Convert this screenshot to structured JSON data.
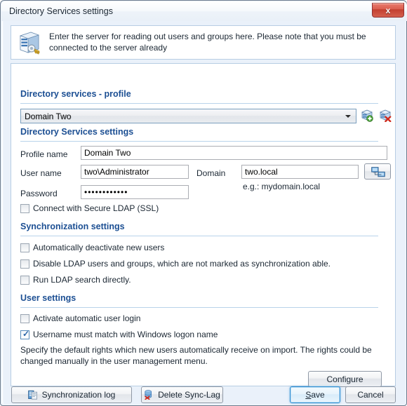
{
  "window": {
    "title": "Directory Services settings",
    "close_label": "x"
  },
  "banner": {
    "icon": "server-key-icon",
    "text": "Enter the server for reading out users and groups here. Please note that you must be connected to the server already"
  },
  "profile_section": {
    "heading": "Directory services - profile",
    "combo_value": "Domain Two",
    "add_icon": "add-server-icon",
    "delete_icon": "delete-server-icon"
  },
  "settings_section": {
    "heading": "Directory Services settings",
    "fields": {
      "profile_name_label": "Profile name",
      "profile_name_value": "Domain Two",
      "user_name_label": "User name",
      "user_name_value": "two\\Administrator",
      "domain_label": "Domain",
      "domain_value": "two.local",
      "domain_hint": "e.g.: mydomain.local",
      "domain_browse_icon": "network-computers-icon",
      "password_label": "Password",
      "password_value": "••••••••••••"
    },
    "ssl_checkbox": {
      "label": "Connect with Secure LDAP (SSL)",
      "checked": false
    }
  },
  "sync_section": {
    "heading": "Synchronization settings",
    "checkboxes": [
      {
        "label": "Automatically deactivate new users",
        "checked": false
      },
      {
        "label": "Disable LDAP users and groups, which are not marked as synchronization able.",
        "checked": false
      },
      {
        "label": "Run LDAP search directly.",
        "checked": false
      }
    ]
  },
  "user_section": {
    "heading": "User settings",
    "checkboxes": [
      {
        "label": "Activate automatic user login",
        "checked": false
      },
      {
        "label": "Username must match with Windows logon name",
        "checked": true
      }
    ],
    "note": "Specify the default rights which new users automatically receive on import. The rights could be changed manually in the user management menu.",
    "configure_label": "Configure"
  },
  "footer": {
    "sync_log_label": "Synchronization log",
    "sync_log_icon": "log-book-icon",
    "delete_sync_label": "Delete Sync-Lag",
    "delete_sync_icon": "delete-database-icon",
    "save_label_accel": "S",
    "save_label_rest": "ave",
    "cancel_label": "Cancel"
  },
  "colors": {
    "heading_blue": "#1c4f93",
    "panel_bg": "#ffffff",
    "dialog_bg": "#eaf1fa",
    "accent_border": "#b7cde3",
    "default_button_border": "#2e8fd4",
    "close_red": "#c33f2f"
  }
}
